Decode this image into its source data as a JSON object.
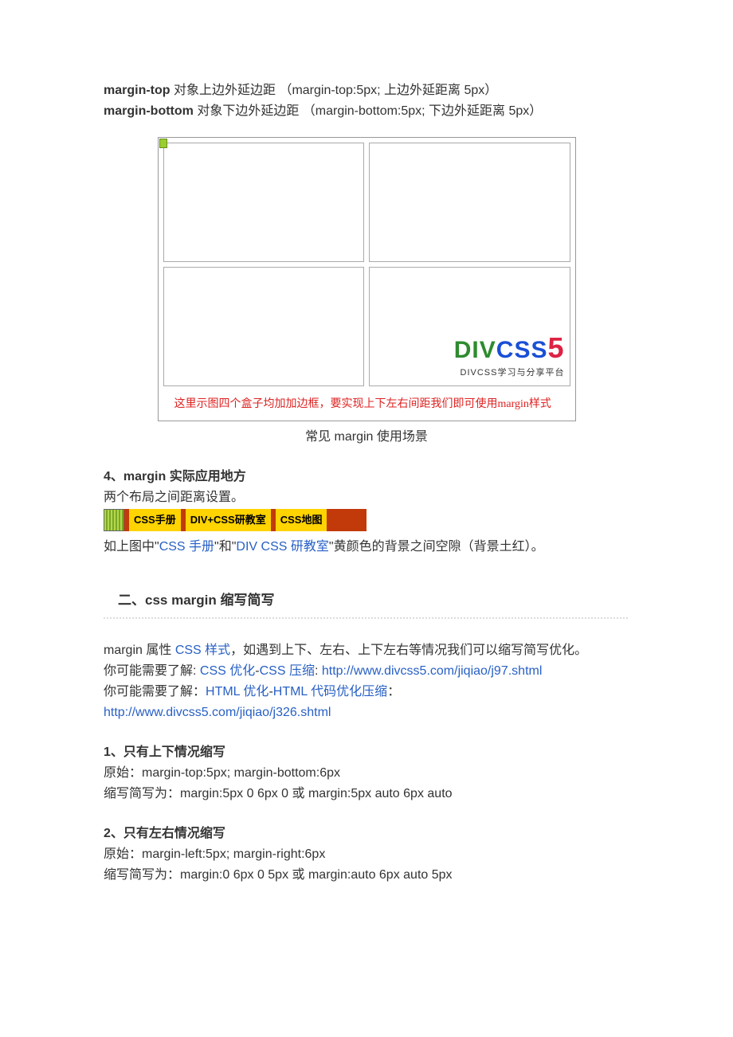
{
  "para1": {
    "b1": "margin-top",
    "t1": " 对象上边外延边距 （margin-top:5px; 上边外延距离 5px）",
    "b2": "margin-bottom",
    "t2": " 对象下边外延边距 （margin-bottom:5px; 下边外延距离 5px）"
  },
  "figure1": {
    "logo_div": "DIV",
    "logo_css": "CSS",
    "logo_5": "5",
    "logo_sub": "DIVCSS学习与分享平台",
    "red_caption": "这里示图四个盒子均加加边框，要实现上下左右间距我们即可使用margin样式",
    "caption": "常见 margin 使用场景"
  },
  "section4": {
    "title": "4、margin 实际应用地方",
    "line1": "两个布局之间距离设置。",
    "nav": {
      "tab1": "CSS手册",
      "tab2": "DIV+CSS研教室",
      "tab3": "CSS地图"
    },
    "after": {
      "pre": "如上图中\"",
      "link1": "CSS 手册",
      "mid1": "\"和\"",
      "link2": "DIV CSS 研教室",
      "post": "\"黄颜色的背景之间空隙（背景土红）。"
    }
  },
  "section2_head": "二、css margin 缩写简写",
  "para3": {
    "p1a": "margin 属性 ",
    "p1link": "CSS 样式",
    "p1b": "，如遇到上下、左右、上下左右等情况我们可以缩写简写优化。",
    "p2a": "你可能需要了解: ",
    "p2link1": "CSS 优化",
    "dash": "-",
    "p2link2": "CSS 压缩",
    "p2b": ": ",
    "p2url": "http://www.divcss5.com/jiqiao/j97.shtml",
    "p3a": "你可能需要了解：",
    "p3link1": "HTML 优化",
    "p3link2": "HTML 代码优化压缩",
    "p3b": "：",
    "p3url": "http://www.divcss5.com/jiqiao/j326.shtml"
  },
  "sub1": {
    "title": "1、只有上下情况缩写",
    "l1": "原始：margin-top:5px; margin-bottom:6px",
    "l2": "缩写简写为：margin:5px 0 6px 0 或 margin:5px auto 6px auto"
  },
  "sub2": {
    "title": "2、只有左右情况缩写",
    "l1": "原始：margin-left:5px; margin-right:6px",
    "l2": "缩写简写为：margin:0 6px 0 5px 或 margin:auto 6px auto 5px"
  }
}
